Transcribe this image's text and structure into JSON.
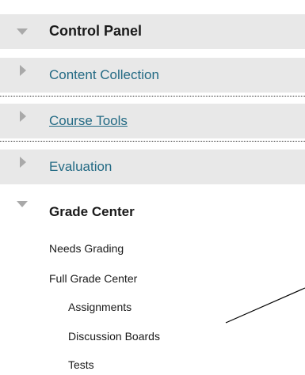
{
  "control_panel": {
    "title": "Control Panel",
    "items": [
      {
        "label": "Content Collection"
      },
      {
        "label": "Course Tools"
      },
      {
        "label": "Evaluation"
      }
    ]
  },
  "grade_center": {
    "title": "Grade Center",
    "items": [
      {
        "label": "Needs Grading"
      },
      {
        "label": "Full Grade Center"
      },
      {
        "label": "Assignments"
      },
      {
        "label": "Discussion Boards"
      },
      {
        "label": "Tests"
      }
    ]
  },
  "colors": {
    "link": "#236a84",
    "row_bg": "#e8e8e8",
    "triangle": "#a9a9a9"
  }
}
